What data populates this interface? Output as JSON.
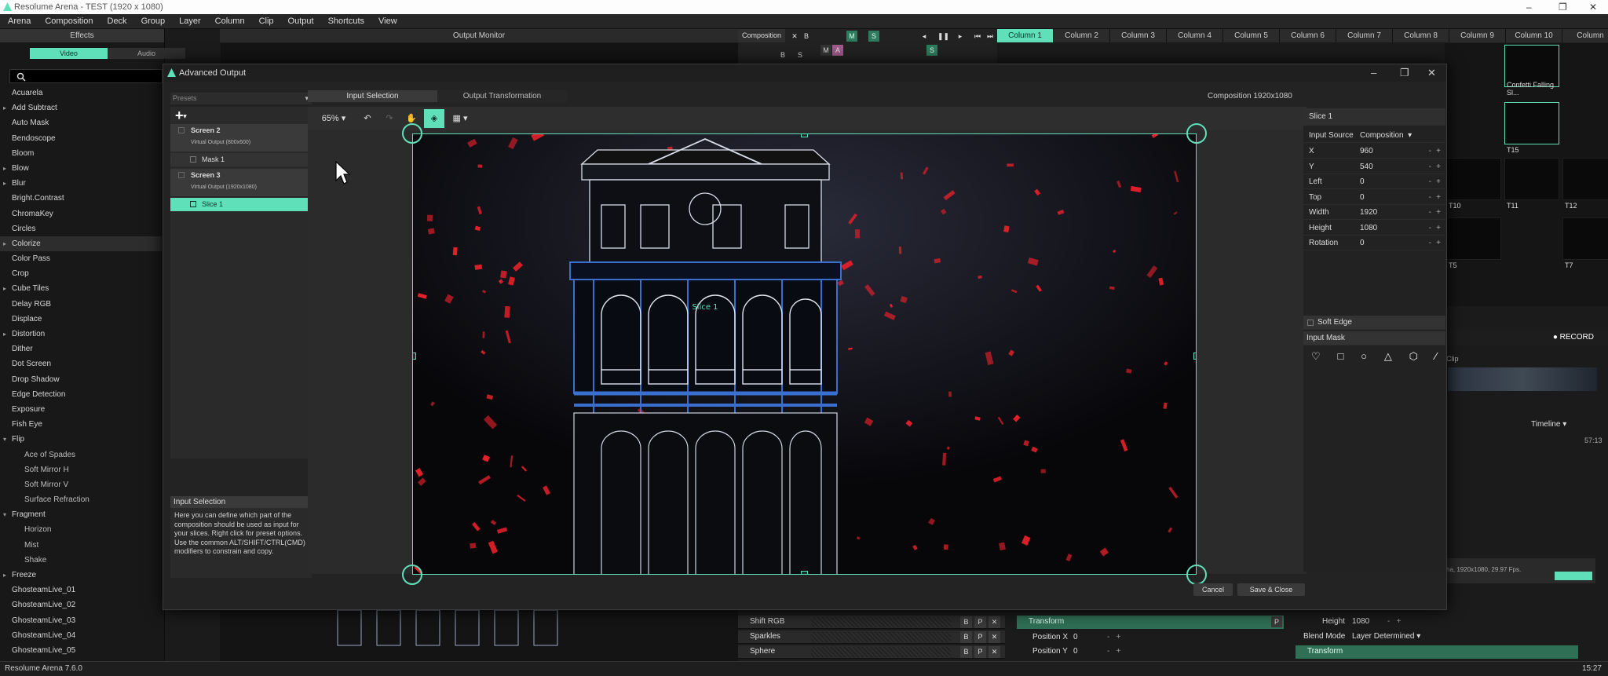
{
  "window": {
    "title": "Resolume Arena - TEST (1920 x 1080)",
    "min": "–",
    "max": "❐",
    "close": "✕"
  },
  "menu": [
    "Arena",
    "Composition",
    "Deck",
    "Group",
    "Layer",
    "Column",
    "Clip",
    "Output",
    "Shortcuts",
    "View"
  ],
  "effects_panel": {
    "title": "Effects",
    "tab_video": "Video",
    "tab_audio": "Audio",
    "items": [
      {
        "label": "Acuarela",
        "sub": false,
        "arrow": false
      },
      {
        "label": "Add Subtract",
        "sub": false,
        "arrow": true
      },
      {
        "label": "Auto Mask",
        "sub": false,
        "arrow": false
      },
      {
        "label": "Bendoscope",
        "sub": false,
        "arrow": false
      },
      {
        "label": "Bloom",
        "sub": false,
        "arrow": false
      },
      {
        "label": "Blow",
        "sub": false,
        "arrow": true
      },
      {
        "label": "Blur",
        "sub": false,
        "arrow": true
      },
      {
        "label": "Bright.Contrast",
        "sub": false,
        "arrow": false
      },
      {
        "label": "ChromaKey",
        "sub": false,
        "arrow": false
      },
      {
        "label": "Circles",
        "sub": false,
        "arrow": false
      },
      {
        "label": "Colorize",
        "sub": false,
        "arrow": true
      },
      {
        "label": "Color Pass",
        "sub": false,
        "arrow": false
      },
      {
        "label": "Crop",
        "sub": false,
        "arrow": false
      },
      {
        "label": "Cube Tiles",
        "sub": false,
        "arrow": true
      },
      {
        "label": "Delay RGB",
        "sub": false,
        "arrow": false
      },
      {
        "label": "Displace",
        "sub": false,
        "arrow": false
      },
      {
        "label": "Distortion",
        "sub": false,
        "arrow": true
      },
      {
        "label": "Dither",
        "sub": false,
        "arrow": false
      },
      {
        "label": "Dot Screen",
        "sub": false,
        "arrow": false
      },
      {
        "label": "Drop Shadow",
        "sub": false,
        "arrow": false
      },
      {
        "label": "Edge Detection",
        "sub": false,
        "arrow": false
      },
      {
        "label": "Exposure",
        "sub": false,
        "arrow": false
      },
      {
        "label": "Fish Eye",
        "sub": false,
        "arrow": false
      },
      {
        "label": "Flip",
        "sub": false,
        "arrow": true,
        "open": true
      },
      {
        "label": "Ace of Spades",
        "sub": true,
        "arrow": false
      },
      {
        "label": "Soft Mirror H",
        "sub": true,
        "arrow": false
      },
      {
        "label": "Soft Mirror V",
        "sub": true,
        "arrow": false
      },
      {
        "label": "Surface Refraction",
        "sub": true,
        "arrow": false
      },
      {
        "label": "Fragment",
        "sub": false,
        "arrow": true,
        "open": true
      },
      {
        "label": "Horizon",
        "sub": true,
        "arrow": false
      },
      {
        "label": "Mist",
        "sub": true,
        "arrow": false
      },
      {
        "label": "Shake",
        "sub": true,
        "arrow": false
      },
      {
        "label": "Freeze",
        "sub": false,
        "arrow": true
      },
      {
        "label": "GhosteamLive_01",
        "sub": false,
        "arrow": false
      },
      {
        "label": "GhosteamLive_02",
        "sub": false,
        "arrow": false
      },
      {
        "label": "GhosteamLive_03",
        "sub": false,
        "arrow": false
      },
      {
        "label": "GhosteamLive_04",
        "sub": false,
        "arrow": false
      },
      {
        "label": "GhosteamLive_05",
        "sub": false,
        "arrow": false
      }
    ],
    "selected_index": 10
  },
  "output_monitor": {
    "title": "Output Monitor"
  },
  "composition_bar": {
    "label": "Composition",
    "x": "✕",
    "b": "B",
    "m": "M",
    "s": "S",
    "a": "A"
  },
  "columns": [
    "Column 1",
    "Column 2",
    "Column 3",
    "Column 4",
    "Column 5",
    "Column 6",
    "Column 7",
    "Column 8",
    "Column 9",
    "Column 10",
    "Column"
  ],
  "clips": [
    {
      "label": "Confetti Falling Sl..."
    },
    {
      "label": "T15"
    },
    {
      "label": "T10"
    },
    {
      "label": "T11"
    },
    {
      "label": "T12"
    },
    {
      "label": "T5"
    },
    {
      "label": "T7"
    }
  ],
  "record": "● RECORD",
  "clip_panel": {
    "title": "Clip",
    "timeline": "Timeline",
    "time": "57:13",
    "fps_info": "ha, 1920x1080, 29.97 Fps."
  },
  "dialog": {
    "title": "Advanced Output",
    "presets": "Presets",
    "add": "+",
    "screens": [
      {
        "name": "Screen 2",
        "sub": "Virtual Output (800x600)",
        "child": "Mask 1"
      },
      {
        "name": "Screen 3",
        "sub": "Virtual Output (1920x1080)",
        "child": "Slice 1"
      }
    ],
    "tab_input": "Input Selection",
    "tab_output": "Output Transformation",
    "composition_size": "Composition 1920x1080",
    "zoom": "65%",
    "slice_label": "Slice 1",
    "info_title": "Input Selection",
    "info_text": "Here you can define which part of the composition should be used as input for your slices. Right click for preset options. Use the common ALT/SHIFT/CTRL(CMD) modifiers to constrain and copy.",
    "props": {
      "title": "Slice 1",
      "input_source_label": "Input Source",
      "input_source_value": "Composition",
      "rows": [
        {
          "k": "X",
          "v": "960"
        },
        {
          "k": "Y",
          "v": "540"
        },
        {
          "k": "Left",
          "v": "0"
        },
        {
          "k": "Top",
          "v": "0"
        },
        {
          "k": "Width",
          "v": "1920"
        },
        {
          "k": "Height",
          "v": "1080"
        },
        {
          "k": "Rotation",
          "v": "0"
        }
      ],
      "soft_edge": "Soft Edge",
      "input_mask": "Input Mask"
    },
    "cancel": "Cancel",
    "save_close": "Save & Close"
  },
  "bottom": {
    "effects": [
      {
        "name": "Shift RGB"
      },
      {
        "name": "Sparkles"
      },
      {
        "name": "Sphere"
      }
    ],
    "transform": "Transform",
    "position_x_label": "Position X",
    "position_x": "0",
    "position_y_label": "Position Y",
    "position_y": "0",
    "height_label": "Height",
    "height_value": "1080",
    "blend_label": "Blend Mode",
    "blend_value": "Layer Determined",
    "transform2": "Transform"
  },
  "status": {
    "left": "Resolume Arena 7.6.0",
    "right": "15:27"
  },
  "colors": {
    "accent": "#5fe0b8",
    "red": "#e8202a",
    "blue": "#3a6fd0"
  }
}
